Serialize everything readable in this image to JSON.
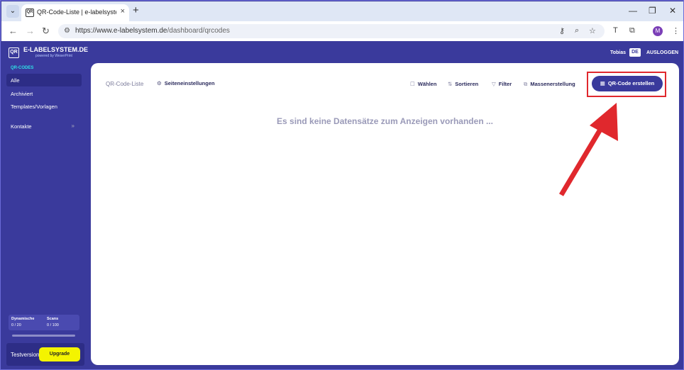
{
  "browser": {
    "tab_title": "QR-Code-Liste | e-labelsystem.de",
    "tab_close": "×",
    "new_tab": "+",
    "url_domain": "https://www.e-labelsystem.de",
    "url_path": "/dashboard/qrcodes",
    "profile_initial": "M"
  },
  "app": {
    "logo_mark": "QR",
    "logo_name": "E-LABELSYSTEM.DE",
    "logo_sub": "powered by WeserPrint",
    "user_name": "Tobias",
    "language": "DE",
    "logout_label": "AUSLOGGEN"
  },
  "sidebar": {
    "section_title": "QR-CODES",
    "items": [
      {
        "label": "Alle",
        "active": true
      },
      {
        "label": "Archiviert"
      },
      {
        "label": "Templates/Vorlagen"
      },
      {
        "label": "Kontakte"
      }
    ],
    "expand_icon": "»",
    "quota": {
      "dynamic_label": "Dynamische",
      "dynamic_value": "0 / 20",
      "scans_label": "Scans",
      "scans_value": "0 / 100",
      "dynamic_fill": 0,
      "scans_fill": 0
    },
    "trial_label": "Testversion",
    "upgrade_label": "Upgrade"
  },
  "main": {
    "breadcrumb": "QR-Code-Liste",
    "page_settings_label": "Seiteneinstellungen",
    "toolbar": {
      "select_label": "Wählen",
      "sort_label": "Sortieren",
      "filter_label": "Filter",
      "bulk_label": "Massenerstellung",
      "create_label": "QR-Code erstellen"
    },
    "empty_message": "Es sind keine Datensätze zum Anzeigen vorhanden ..."
  },
  "annotation_color": "#e0282d"
}
